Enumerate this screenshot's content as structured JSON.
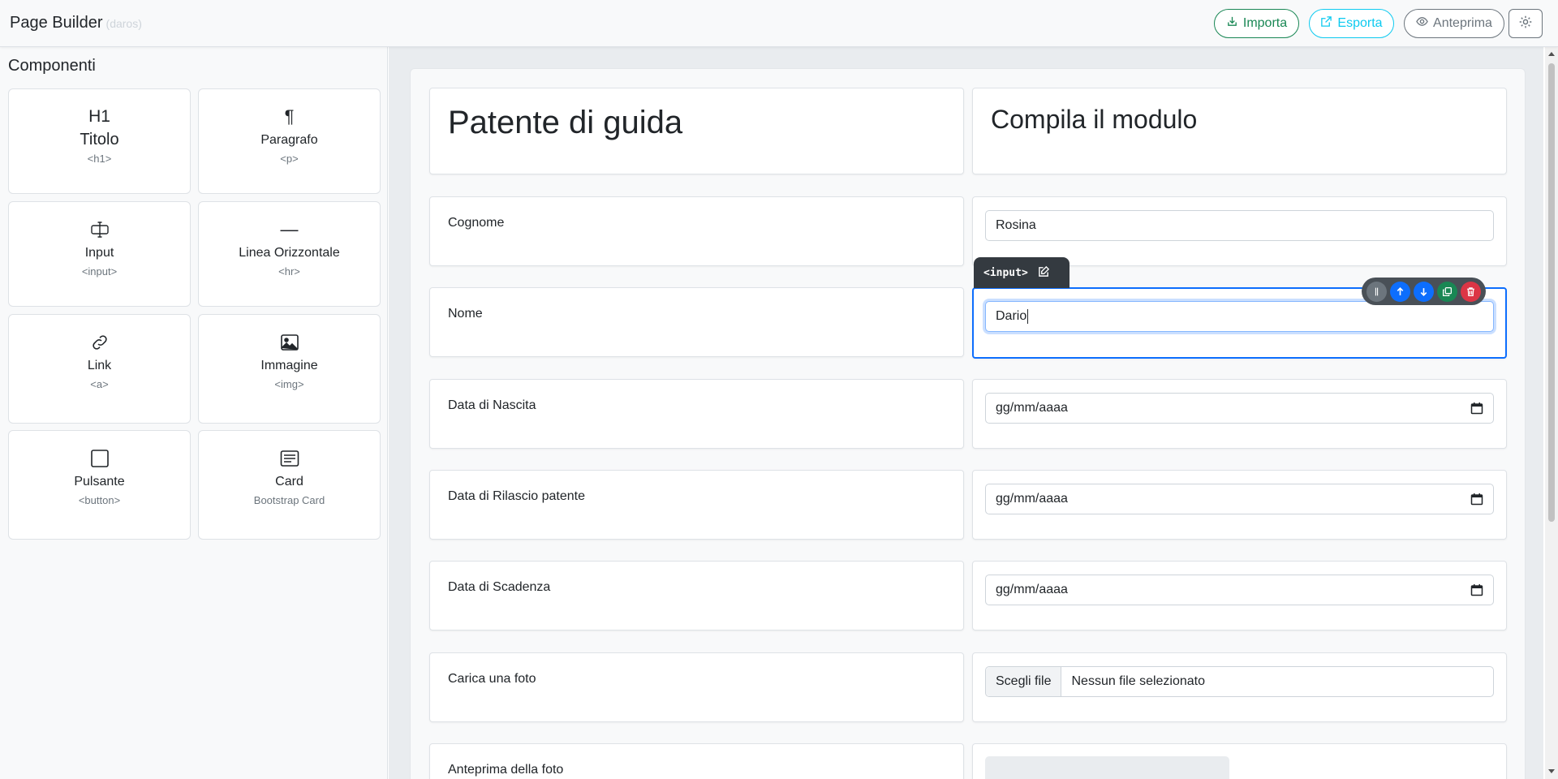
{
  "header": {
    "title": "Page Builder",
    "subtitle": "(daros)",
    "import_label": "Importa",
    "export_label": "Esporta",
    "preview_label": "Anteprima"
  },
  "sidebar": {
    "title": "Componenti",
    "components": [
      {
        "icon": "H1",
        "name": "Titolo",
        "tag": "<h1>"
      },
      {
        "icon": "¶",
        "name": "Paragrafo",
        "tag": "<p>"
      },
      {
        "icon": "input-cursor-icon",
        "name": "Input",
        "tag": "<input>"
      },
      {
        "icon": "—",
        "name": "Linea Orizzontale",
        "tag": "<hr>"
      },
      {
        "icon": "link-icon",
        "name": "Link",
        "tag": "<a>"
      },
      {
        "icon": "image-icon",
        "name": "Immagine",
        "tag": "<img>"
      },
      {
        "icon": "square-icon",
        "name": "Pulsante",
        "tag": "<button>"
      },
      {
        "icon": "card-text-icon",
        "name": "Card",
        "tag": "Bootstrap Card"
      }
    ]
  },
  "form": {
    "title": "Patente di guida",
    "subtitle": "Compila il modulo",
    "rows": [
      {
        "label": "Cognome",
        "value": "Rosina"
      },
      {
        "label": "Nome",
        "value": "Dario"
      },
      {
        "label": "Data di Nascita",
        "value": "gg/mm/aaaa"
      },
      {
        "label": "Data di Rilascio patente",
        "value": "gg/mm/aaaa"
      },
      {
        "label": "Data di Scadenza",
        "value": "gg/mm/aaaa"
      },
      {
        "label": "Carica una foto",
        "button": "Scegli file",
        "value": "Nessun file selezionato"
      },
      {
        "label": "Anteprima della foto"
      }
    ]
  },
  "selection": {
    "tag": "<input>"
  },
  "colors": {
    "import": "#198754",
    "export": "#0dcaf0",
    "preview": "#6c757d",
    "selected": "#0d6efd",
    "delete": "#dc3545"
  }
}
